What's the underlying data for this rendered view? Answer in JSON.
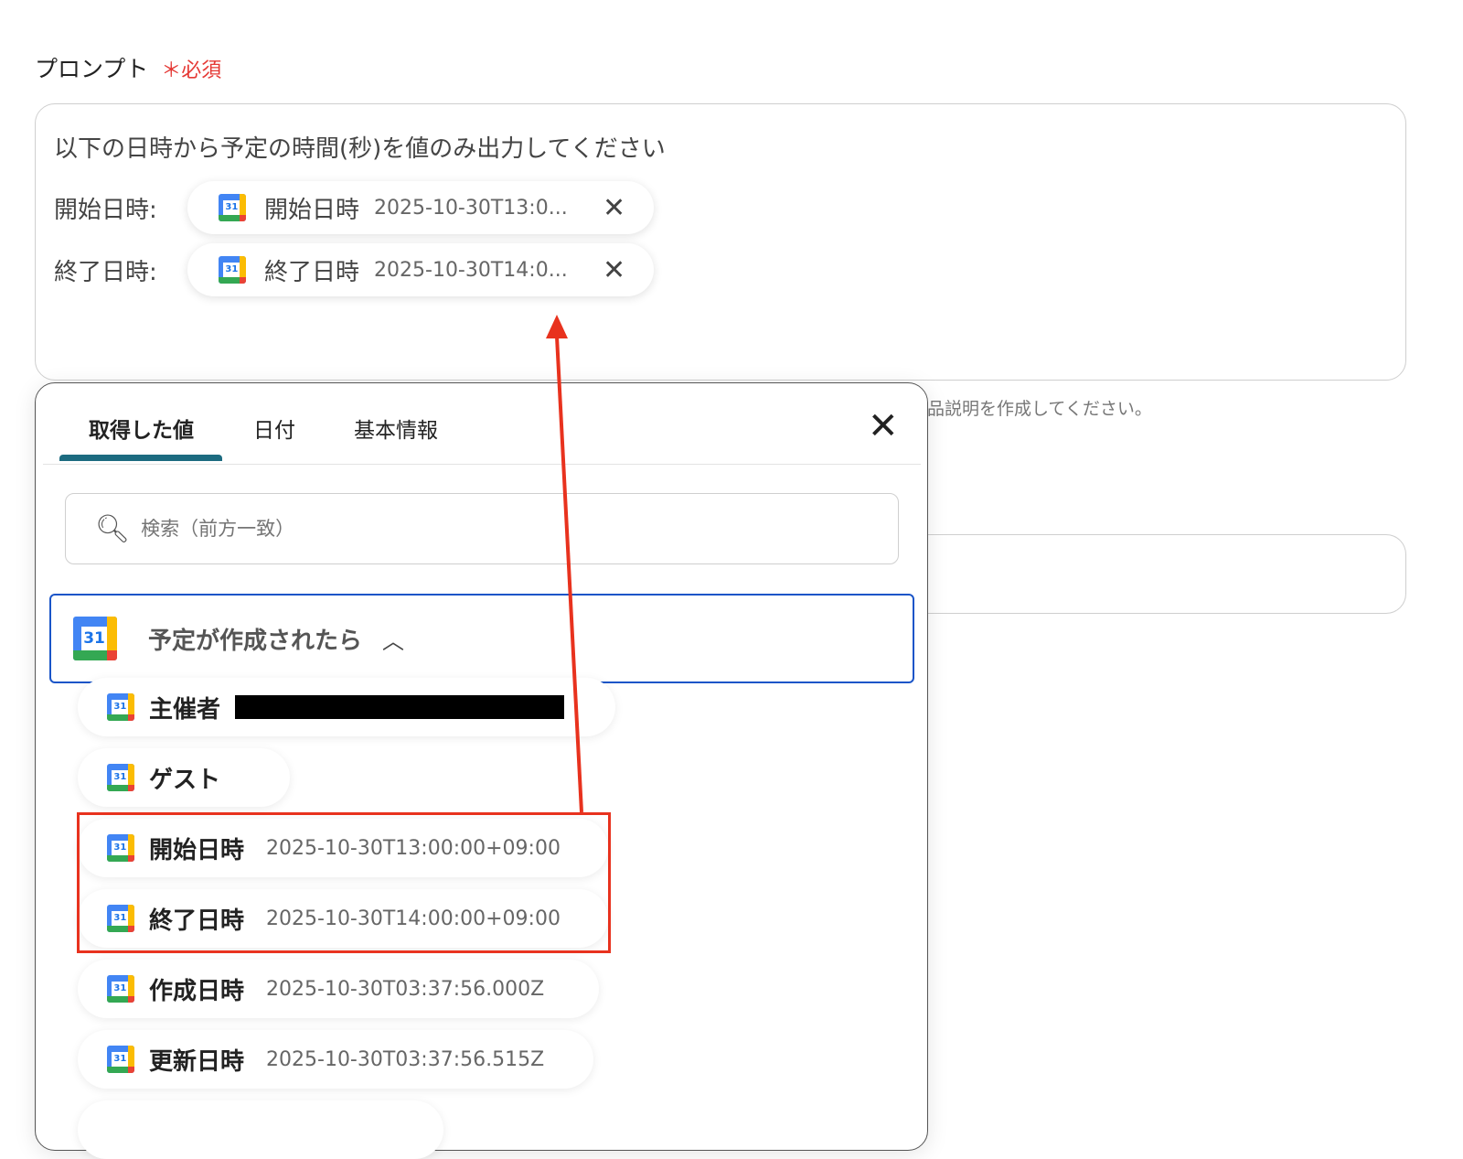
{
  "prompt_field": {
    "label": "プロンプト",
    "required": "＊必須",
    "text": "以下の日時から予定の時間(秒)を値のみ出力してください",
    "rows": [
      {
        "label": "開始日時:",
        "chip_name": "開始日時",
        "chip_value": "2025-10-30T13:0...",
        "remove_icon": "close-icon"
      },
      {
        "label": "終了日時:",
        "chip_name": "終了日時",
        "chip_value": "2025-10-30T14:0...",
        "remove_icon": "close-icon"
      }
    ]
  },
  "background_hint": "品説明を作成してください。",
  "picker": {
    "tabs": [
      "取得した値",
      "日付",
      "基本情報"
    ],
    "active_tab": "取得した値",
    "close_icon": "close-icon",
    "search": {
      "placeholder": "検索（前方一致）",
      "icon": "search-icon"
    },
    "group": {
      "title": "予定が作成されたら",
      "icon": "google-calendar-icon",
      "icon_text": "31",
      "expanded": true
    },
    "items": [
      {
        "name": "主催者",
        "value": ""
      },
      {
        "name": "ゲスト",
        "value": ""
      },
      {
        "name": "開始日時",
        "value": "2025-10-30T13:00:00+09:00"
      },
      {
        "name": "終了日時",
        "value": "2025-10-30T14:00:00+09:00"
      },
      {
        "name": "作成日時",
        "value": "2025-10-30T03:37:56.000Z"
      },
      {
        "name": "更新日時",
        "value": "2025-10-30T03:37:56.515Z"
      }
    ]
  },
  "colors": {
    "required": "#e53935",
    "highlight": "#e8321e",
    "tab_indicator": "#1c6b80",
    "group_border": "#1a55c8"
  }
}
